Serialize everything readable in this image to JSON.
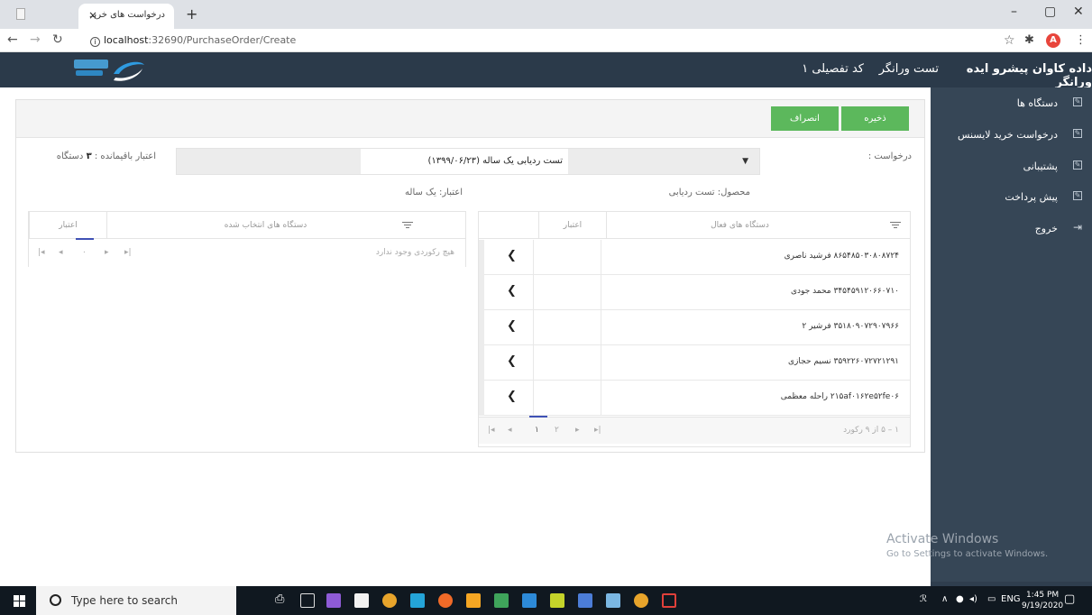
{
  "browser": {
    "tab_title": "درخواست های خرید",
    "tab_close": "×",
    "new_tab": "+",
    "url_host": "localhost",
    "url_rest": ":32690/PurchaseOrder/Create",
    "avatar_letter": "A",
    "window_controls": [
      "–",
      "▢",
      "✕"
    ]
  },
  "header": {
    "company": "داده کاوان پیشرو ایده ورانگر",
    "test": "تست ورانگر",
    "code": "کد تفصیلی ۱"
  },
  "sidebar": {
    "items": [
      {
        "label": "دستگاه ها",
        "icon": "edit-icon"
      },
      {
        "label": "درخواست خرید لایسنس",
        "icon": "edit-icon"
      },
      {
        "label": "پشتیبانی",
        "icon": "edit-icon"
      },
      {
        "label": "پیش پرداخت",
        "icon": "edit-icon"
      },
      {
        "label": "خروج",
        "icon": "sign-out-icon"
      }
    ]
  },
  "form": {
    "save_label": "ذخیره",
    "cancel_label": "انصراف",
    "request_label": "درخواست :",
    "select_value": "تست ردیابی یک ساله (۱۳۹۹/۰۶/۲۳)",
    "remaining_label": "اعتبار باقیمانده :",
    "remaining_count": "۳",
    "remaining_unit": "دستگاه",
    "product_label": "محصول: تست ردیابی",
    "validity_label": "اعتبار: یک ساله"
  },
  "active_grid": {
    "col_devices": "دستگاه های فعال",
    "col_validity": "اعتبار",
    "rows": [
      {
        "name": "۸۶۵۴۸۵۰۳۰۸۰۸۷۲۴ فرشید ناصری"
      },
      {
        "name": "۳۴۵۴۵۹۱۲۰۶۶۰۷۱۰ محمد جودی"
      },
      {
        "name": "۳۵۱۸۰۹۰۷۲۹۰۷۹۶۶ فرشیر ۲"
      },
      {
        "name": "۳۵۹۲۲۶۰۷۲۷۲۱۲۹۱ نسیم حجازی"
      },
      {
        "name": "۲۱۵af۰۱۶۲e۵۲fe۰۶ راحله معظمی"
      }
    ],
    "pager_info": "۱ – ۵ از ۹ رکورد",
    "pages": [
      "۱",
      "۲"
    ],
    "nav": {
      "first": "|◂",
      "prev": "◂",
      "next": "▸",
      "last": "▸|"
    }
  },
  "selected_grid": {
    "col_devices": "دستگاه های انتخاب شده",
    "col_validity": "اعتبار",
    "empty_text": "هیچ رکوردی وجود ندارد",
    "page": "۰",
    "nav": {
      "first": "|◂",
      "prev": "◂",
      "next": "▸",
      "last": "▸|"
    }
  },
  "watermark": {
    "line1": "Activate Windows",
    "line2": "Go to Settings to activate Windows."
  },
  "taskbar": {
    "search_placeholder": "Type here to search",
    "lang": "ENG",
    "time": "1:45 PM",
    "date": "9/19/2020"
  },
  "colors": {
    "header": "#2b3a4a",
    "sidebar": "#364656",
    "accent_green": "#5cb85c",
    "pager_active": "#3f51b5"
  }
}
